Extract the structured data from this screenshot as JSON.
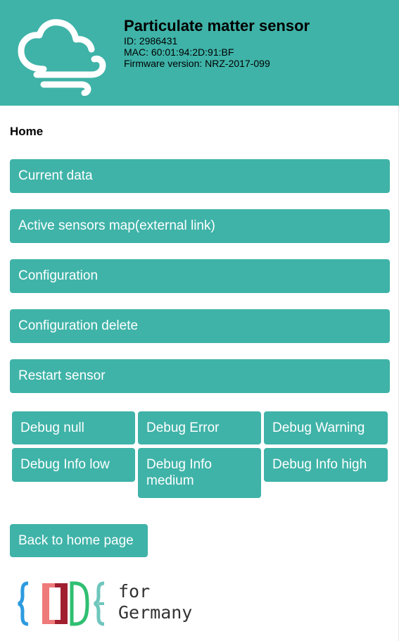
{
  "header": {
    "title": "Particulate matter sensor",
    "id_line": "ID: 2986431",
    "mac_line": "MAC: 60:01:94:2D:91:BF",
    "firmware_line": "Firmware version: NRZ-2017-099",
    "logo_icon": "cloud-wind-icon",
    "color": "#3fb3a8"
  },
  "page": {
    "section_title": "Home"
  },
  "menu": [
    {
      "label": "Current data"
    },
    {
      "label": "Active sensors map(external link)"
    },
    {
      "label": "Configuration"
    },
    {
      "label": "Configuration delete"
    },
    {
      "label": "Restart sensor"
    }
  ],
  "debug": [
    {
      "label": "Debug null"
    },
    {
      "label": "Debug Error"
    },
    {
      "label": "Debug Warning"
    },
    {
      "label": "Debug Info low"
    },
    {
      "label": "Debug Info medium"
    },
    {
      "label": "Debug Info high"
    }
  ],
  "back": {
    "label": "Back to home page"
  },
  "footer": {
    "logo_word_for": "for",
    "logo_word_country": "Germany"
  }
}
